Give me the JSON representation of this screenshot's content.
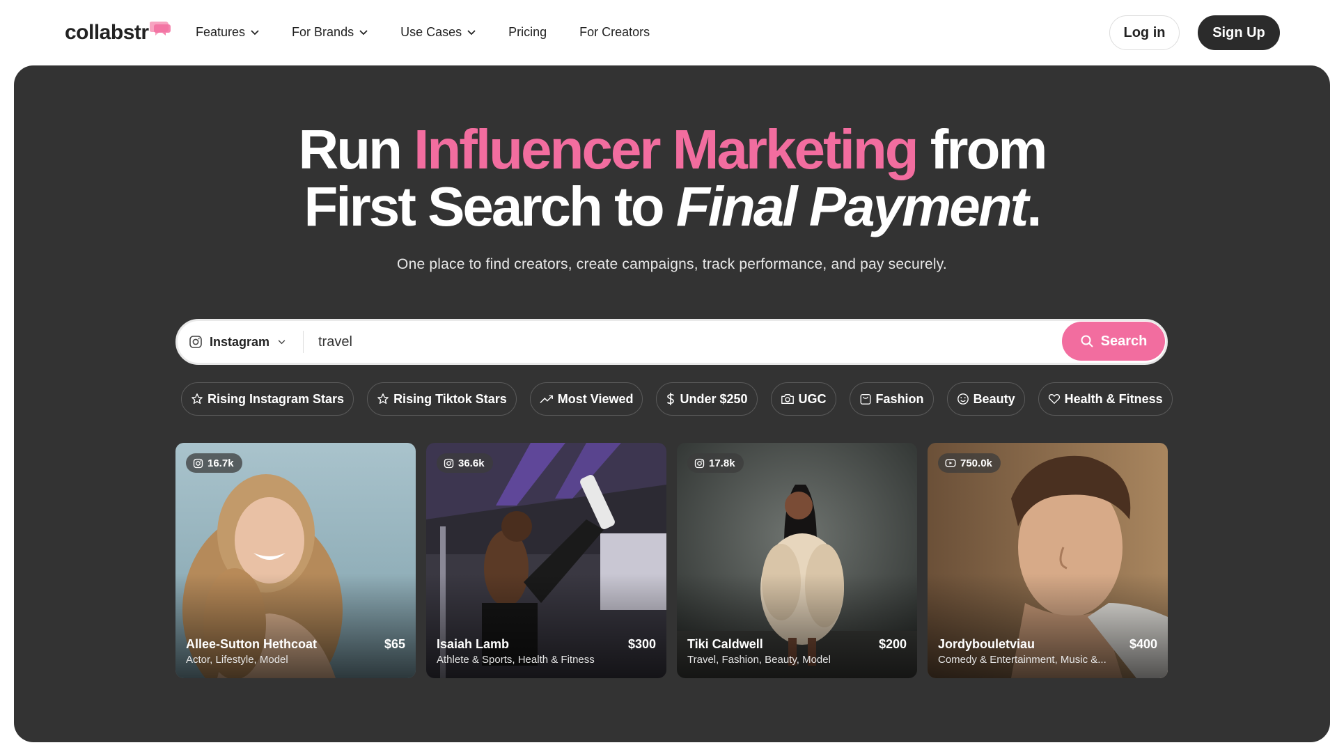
{
  "brand": {
    "logo_text": "collabstr",
    "accent": "#f26d9f",
    "dark": "#333333"
  },
  "nav": {
    "items": [
      {
        "label": "Features",
        "dropdown": true
      },
      {
        "label": "For Brands",
        "dropdown": true
      },
      {
        "label": "Use Cases",
        "dropdown": true
      },
      {
        "label": "Pricing",
        "dropdown": false
      },
      {
        "label": "For Creators",
        "dropdown": false
      }
    ],
    "login_label": "Log in",
    "signup_label": "Sign Up"
  },
  "hero": {
    "line1_a": "Run ",
    "line1_pink": "Influencer Marketing",
    "line1_b": " from",
    "line2_a": "First Search to ",
    "line2_italic": "Final Payment",
    "line2_end": ".",
    "subhead": "One place to find creators, create campaigns, track performance, and pay securely."
  },
  "search": {
    "platform": "Instagram",
    "platform_icon": "instagram-icon",
    "query": "travel",
    "button_label": "Search"
  },
  "chips": [
    {
      "label": "Rising Instagram Stars",
      "icon": "star-icon"
    },
    {
      "label": "Rising Tiktok Stars",
      "icon": "star-icon"
    },
    {
      "label": "Most Viewed",
      "icon": "trending-icon"
    },
    {
      "label": "Under $250",
      "icon": "dollar-icon"
    },
    {
      "label": "UGC",
      "icon": "camera-icon"
    },
    {
      "label": "Fashion",
      "icon": "bag-icon"
    },
    {
      "label": "Beauty",
      "icon": "smile-icon"
    },
    {
      "label": "Health & Fitness",
      "icon": "heart-icon"
    }
  ],
  "creators": [
    {
      "followers": "16.7k",
      "platform_icon": "instagram-icon",
      "name": "Allee-Sutton Hethcoat",
      "categories": "Actor, Lifestyle, Model",
      "price": "$65"
    },
    {
      "followers": "36.6k",
      "platform_icon": "instagram-icon",
      "name": "Isaiah Lamb",
      "categories": "Athlete & Sports, Health & Fitness",
      "price": "$300"
    },
    {
      "followers": "17.8k",
      "platform_icon": "instagram-icon",
      "name": "Tiki Caldwell",
      "categories": "Travel, Fashion, Beauty, Model",
      "price": "$200"
    },
    {
      "followers": "750.0k",
      "platform_icon": "youtube-icon",
      "name": "Jordybouletviau",
      "categories": "Comedy & Entertainment, Music &...",
      "price": "$400"
    }
  ]
}
